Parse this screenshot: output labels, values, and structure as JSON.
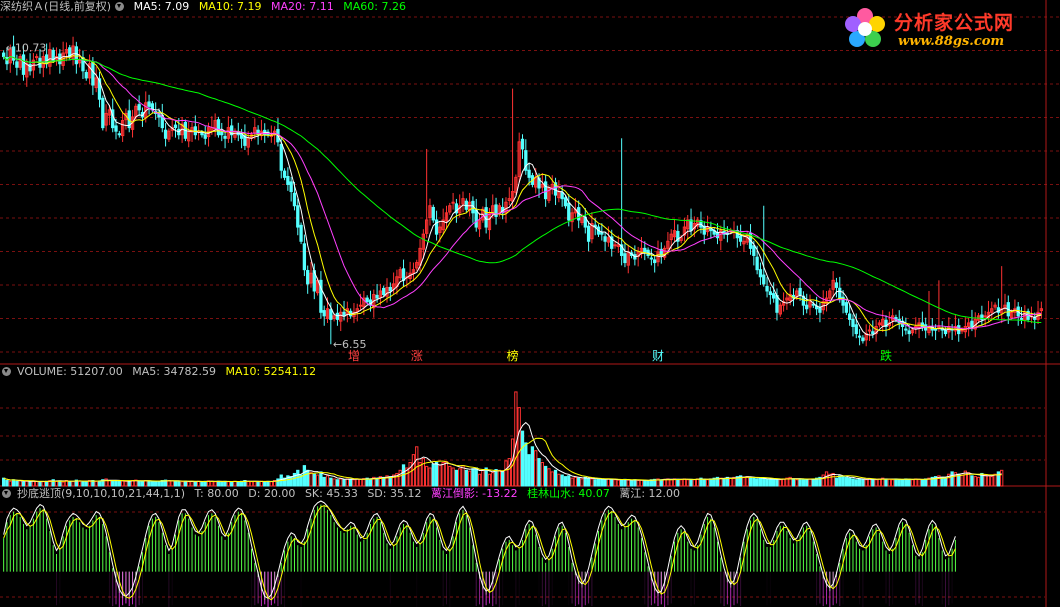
{
  "main_header": {
    "stock": "深纺织Ａ(日线,前复权)",
    "ma5": "MA5: 7.09",
    "ma10": "MA10: 7.19",
    "ma20": "MA20: 7.11",
    "ma60": "MA60: 7.26"
  },
  "volume_header": {
    "label": "VOLUME: 51207.00",
    "ma5": "MA5: 34782.59",
    "ma10": "MA10: 52541.12"
  },
  "indicator_header": {
    "name": "抄底逃顶(9,10,10,10,21,44,1,1)",
    "t": "T: 80.00",
    "d": "D: 20.00",
    "sk": "SK: 45.33",
    "sd": "SD: 35.12",
    "line1": "蓠江倒影: -13.22",
    "line2": "桂林山水: 40.07",
    "line3": "蓠江: 12.00"
  },
  "logo": {
    "title": "分析家公式网",
    "url": "www.88gs.com"
  },
  "colors": {
    "up": "#ff3232",
    "down": "#54ffff",
    "ma5": "#ffffff",
    "ma10": "#ffff00",
    "ma20": "#ff40ff",
    "ma60": "#00ff00",
    "grid": "#7a1010",
    "volMa10": "#ffff00"
  },
  "chart_data": [
    {
      "type": "candlestick",
      "title": "深纺织Ａ(日线,前复权)",
      "ylim": [
        6.3,
        11.2
      ],
      "high_label": "10.73",
      "low_label": "6.55",
      "annotations": [
        {
          "text": "增",
          "color": "#ff4040"
        },
        {
          "text": "涨",
          "color": "#ff4040"
        },
        {
          "text": "榜",
          "color": "#ffff00"
        },
        {
          "text": "财",
          "color": "#54ffff"
        },
        {
          "text": "跌",
          "color": "#00ff00"
        }
      ],
      "annotation_index": [
        106,
        125,
        154,
        198,
        267
      ],
      "close": [
        10.6,
        10.5,
        10.7,
        10.55,
        10.45,
        10.6,
        10.35,
        10.5,
        10.4,
        10.55,
        10.6,
        10.45,
        10.6,
        10.5,
        10.7,
        10.55,
        10.6,
        10.5,
        10.65,
        10.7,
        10.6,
        10.75,
        10.5,
        10.55,
        10.4,
        10.3,
        10.5,
        10.2,
        10.3,
        10.0,
        9.6,
        9.8,
        9.85,
        9.6,
        9.55,
        9.5,
        9.7,
        9.8,
        9.6,
        9.75,
        9.9,
        9.85,
        9.75,
        9.95,
        9.9,
        9.85,
        9.8,
        9.75,
        9.6,
        9.45,
        9.55,
        9.6,
        9.6,
        9.5,
        9.65,
        9.45,
        9.55,
        9.6,
        9.5,
        9.55,
        9.5,
        9.45,
        9.6,
        9.6,
        9.7,
        9.5,
        9.5,
        9.45,
        9.6,
        9.5,
        9.55,
        9.5,
        9.45,
        9.35,
        9.45,
        9.5,
        9.6,
        9.5,
        9.55,
        9.5,
        9.5,
        9.5,
        9.55,
        9.4,
        9.0,
        8.9,
        8.8,
        8.7,
        8.5,
        8.2,
        8.0,
        7.6,
        7.4,
        7.55,
        7.3,
        7.45,
        7.0,
        6.95,
        7.05,
        6.9,
        6.95,
        6.9,
        7.0,
        6.95,
        7.05,
        6.95,
        7.0,
        7.05,
        7.1,
        7.2,
        7.15,
        7.1,
        7.25,
        7.2,
        7.3,
        7.25,
        7.35,
        7.3,
        7.4,
        7.5,
        7.6,
        7.45,
        7.5,
        7.55,
        7.6,
        7.7,
        7.9,
        8.1,
        8.3,
        8.5,
        8.3,
        8.1,
        8.2,
        8.3,
        8.4,
        8.5,
        8.55,
        8.4,
        8.5,
        8.6,
        8.45,
        8.55,
        8.4,
        8.2,
        8.3,
        8.45,
        8.2,
        8.4,
        8.5,
        8.35,
        8.5,
        8.4,
        8.55,
        8.6,
        8.7,
        8.9,
        9.4,
        9.3,
        9.0,
        8.9,
        8.8,
        8.9,
        8.75,
        8.8,
        8.6,
        8.75,
        8.8,
        8.65,
        8.7,
        8.6,
        8.5,
        8.3,
        8.4,
        8.45,
        8.3,
        8.35,
        8.2,
        8.0,
        8.25,
        8.2,
        8.1,
        8.1,
        8.0,
        8.05,
        7.9,
        7.95,
        7.95,
        7.8,
        7.7,
        7.85,
        7.8,
        7.75,
        7.85,
        7.9,
        7.85,
        7.8,
        7.75,
        7.7,
        7.85,
        7.8,
        7.9,
        8.0,
        8.1,
        8.15,
        8.0,
        8.05,
        8.2,
        8.3,
        8.15,
        8.25,
        8.3,
        8.2,
        8.1,
        8.2,
        8.15,
        8.1,
        8.05,
        8.15,
        8.1,
        8.1,
        8.15,
        8.15,
        8.05,
        8.0,
        8.0,
        8.1,
        7.9,
        7.8,
        7.6,
        7.5,
        7.4,
        7.3,
        7.25,
        7.2,
        7.0,
        7.1,
        7.15,
        7.2,
        7.25,
        7.2,
        7.3,
        7.25,
        7.1,
        7.05,
        7.15,
        7.1,
        7.05,
        7.0,
        7.15,
        7.2,
        7.3,
        7.45,
        7.35,
        7.2,
        7.1,
        7.0,
        6.9,
        6.8,
        6.7,
        6.65,
        6.6,
        6.7,
        6.75,
        6.7,
        6.8,
        6.85,
        6.9,
        6.8,
        6.85,
        6.95,
        6.9,
        6.85,
        6.8,
        6.75,
        6.7,
        6.75,
        6.8,
        6.85,
        6.8,
        6.75,
        6.8,
        6.75,
        6.75,
        6.8,
        6.75,
        6.7,
        6.8,
        6.75,
        6.8,
        6.7,
        6.75,
        6.8,
        6.85,
        6.8,
        6.9,
        6.95,
        6.9,
        6.95,
        7.0,
        7.05,
        7.1,
        7.0,
        7.05,
        7.1,
        6.95,
        7.0,
        7.05,
        6.95,
        6.9,
        7.0,
        6.9,
        6.95,
        6.9,
        7.0,
        7.05
      ]
    },
    {
      "type": "bar",
      "title": "VOLUME",
      "ylim": [
        0,
        250000
      ],
      "values": [
        20000,
        14000,
        12000,
        16000,
        12000,
        14000,
        10000,
        12000,
        11000,
        13000,
        12000,
        10000,
        11000,
        12000,
        14000,
        16000,
        12000,
        13000,
        10000,
        14000,
        12000,
        12000,
        15000,
        12000,
        11000,
        12000,
        14000,
        14000,
        12000,
        13000,
        16000,
        18000,
        14000,
        13000,
        12000,
        14000,
        13000,
        12000,
        12000,
        14000,
        15000,
        13000,
        12000,
        14000,
        13000,
        12000,
        11000,
        12000,
        14000,
        15000,
        14000,
        13000,
        12000,
        12000,
        11000,
        12000,
        11000,
        12000,
        11000,
        12000,
        11000,
        12000,
        13000,
        12000,
        11000,
        12000,
        11000,
        12000,
        11000,
        11000,
        12000,
        11000,
        12000,
        14000,
        12000,
        11000,
        12000,
        11000,
        12000,
        11000,
        12000,
        11000,
        14000,
        18000,
        28000,
        20000,
        26000,
        24000,
        32000,
        40000,
        28000,
        52000,
        40000,
        34000,
        30000,
        28000,
        36000,
        22000,
        26000,
        20000,
        18000,
        16000,
        18000,
        16000,
        18000,
        17000,
        16000,
        18000,
        17000,
        19000,
        20000,
        18000,
        22000,
        20000,
        24000,
        22000,
        26000,
        24000,
        28000,
        32000,
        40000,
        54000,
        46000,
        60000,
        80000,
        100000,
        60000,
        70000,
        50000,
        46000,
        56000,
        60000,
        54000,
        60000,
        62000,
        50000,
        46000,
        40000,
        44000,
        52000,
        40000,
        38000,
        44000,
        46000,
        30000,
        40000,
        46000,
        30000,
        34000,
        42000,
        40000,
        36000,
        64000,
        70000,
        120000,
        240000,
        200000,
        140000,
        110000,
        80000,
        100000,
        90000,
        70000,
        60000,
        50000,
        44000,
        36000,
        40000,
        30000,
        28000,
        24000,
        26000,
        20000,
        22000,
        20000,
        18000,
        22000,
        20000,
        18000,
        16000,
        18000,
        17000,
        16000,
        18000,
        17000,
        16000,
        15000,
        16000,
        17000,
        15000,
        14000,
        16000,
        14000,
        15000,
        14000,
        13000,
        16000,
        17000,
        18000,
        16000,
        17000,
        18000,
        16000,
        18000,
        17000,
        16000,
        18000,
        16000,
        17000,
        16000,
        18000,
        20000,
        17000,
        16000,
        18000,
        20000,
        22000,
        20000,
        18000,
        22000,
        20000,
        22000,
        24000,
        26000,
        22000,
        24000,
        22000,
        20000,
        18000,
        20000,
        18000,
        17000,
        16000,
        18000,
        17000,
        16000,
        18000,
        20000,
        22000,
        18000,
        16000,
        18000,
        17000,
        16000,
        18000,
        17000,
        20000,
        22000,
        28000,
        36000,
        30000,
        32000,
        20000,
        26000,
        24000,
        22000,
        20000,
        18000,
        16000,
        18000,
        17000,
        16000,
        18000,
        17000,
        16000,
        18000,
        20000,
        18000,
        17000,
        16000,
        18000,
        17000,
        16000,
        18000,
        17000,
        16000,
        18000,
        17000,
        16000,
        18000,
        20000,
        22000,
        24000,
        26000,
        22000,
        20000,
        30000,
        36000,
        34000,
        30000,
        28000,
        38000,
        34000,
        26000,
        24000,
        22000,
        32000,
        28000,
        26000,
        24000,
        30000,
        36000,
        40000
      ]
    },
    {
      "type": "bar",
      "title": "抄底逃顶(9,10,10,10,21,44,1,1)",
      "ylim": [
        -40,
        80
      ],
      "values": [
        38,
        56,
        64,
        68,
        66,
        62,
        54,
        48,
        52,
        60,
        68,
        72,
        70,
        60,
        46,
        30,
        20,
        26,
        40,
        52,
        58,
        62,
        60,
        56,
        50,
        48,
        52,
        58,
        64,
        62,
        54,
        40,
        22,
        4,
        -12,
        -24,
        -30,
        -32,
        -28,
        -22,
        -10,
        6,
        22,
        38,
        52,
        60,
        62,
        56,
        44,
        30,
        20,
        26,
        42,
        58,
        66,
        66,
        60,
        50,
        42,
        40,
        46,
        56,
        64,
        66,
        62,
        52,
        40,
        36,
        44,
        56,
        64,
        68,
        66,
        58,
        44,
        26,
        10,
        -6,
        -22,
        -32,
        -34,
        -30,
        -20,
        -6,
        10,
        24,
        34,
        40,
        38,
        30,
        28,
        34,
        48,
        60,
        70,
        74,
        76,
        74,
        70,
        64,
        56,
        50,
        46,
        44,
        48,
        52,
        50,
        42,
        34,
        36,
        44,
        54,
        60,
        62,
        56,
        44,
        32,
        26,
        30,
        40,
        50,
        54,
        52,
        44,
        34,
        28,
        32,
        44,
        56,
        62,
        60,
        50,
        36,
        24,
        20,
        26,
        40,
        56,
        66,
        70,
        64,
        50,
        30,
        10,
        -8,
        -20,
        -26,
        -24,
        -14,
        0,
        14,
        26,
        34,
        36,
        30,
        24,
        26,
        36,
        48,
        54,
        52,
        42,
        28,
        16,
        10,
        14,
        26,
        40,
        50,
        52,
        44,
        28,
        10,
        -4,
        -14,
        -18,
        -12,
        0,
        16,
        32,
        46,
        58,
        66,
        70,
        68,
        62,
        54,
        48,
        50,
        56,
        60,
        58,
        50,
        38,
        22,
        6,
        -10,
        -22,
        -28,
        -26,
        -16,
        0,
        18,
        34,
        44,
        48,
        44,
        34,
        26,
        24,
        30,
        42,
        54,
        62,
        60,
        50,
        34,
        16,
        0,
        -12,
        -18,
        -14,
        -2,
        16,
        34,
        48,
        58,
        62,
        58,
        48,
        36,
        28,
        28,
        36,
        46,
        52,
        52,
        46,
        38,
        32,
        34,
        42,
        50,
        52,
        46,
        34,
        20,
        6,
        -8,
        -18,
        -22,
        -18,
        -6,
        10,
        26,
        38,
        44,
        42,
        34,
        26,
        24,
        30,
        40,
        48,
        50,
        44,
        34,
        24,
        20,
        26,
        38,
        50,
        56,
        54,
        44,
        30,
        18,
        14,
        22,
        36,
        48,
        54,
        50,
        38,
        24,
        14,
        16,
        26,
        36
      ]
    }
  ]
}
